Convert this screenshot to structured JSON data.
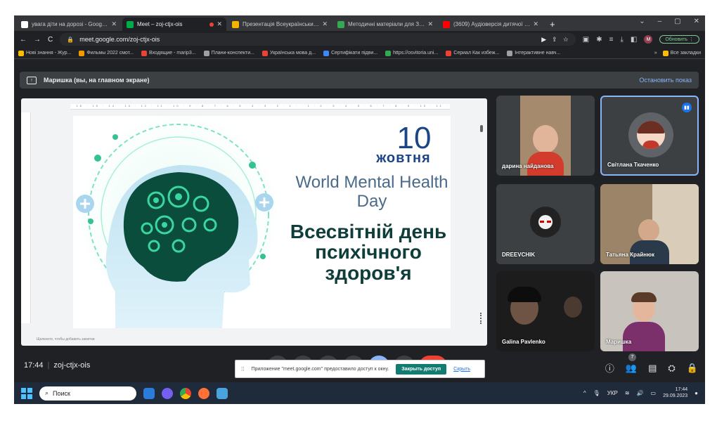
{
  "browser": {
    "tabs": [
      {
        "title": "увага діти на дорозі - Google П...",
        "favicon_color": "#ffffff",
        "active": false,
        "recording": false
      },
      {
        "title": "Meet – zoj-ctjx-ois",
        "favicon_color": "#00ac47",
        "active": true,
        "recording": true
      },
      {
        "title": "Презентація Всеукраїнський ур...",
        "favicon_color": "#f4b400",
        "active": false,
        "recording": false
      },
      {
        "title": "Методичні матеріали для ЗДО ...",
        "favicon_color": "#34a853",
        "active": false,
        "recording": false
      },
      {
        "title": "(3609) Аудіоверсія дитячої книг...",
        "favicon_color": "#ff0000",
        "active": false,
        "recording": false
      }
    ],
    "new_tab_label": "+",
    "window_controls": [
      "⌄",
      "–",
      "▢",
      "✕"
    ],
    "nav": {
      "back": "←",
      "forward": "→",
      "reload": "C"
    },
    "url": "meet.google.com/zoj-ctjx-ois",
    "lock": "🔒",
    "toolbar_icons": [
      "▶",
      "⇪",
      "☆",
      "▣",
      "✱",
      "≡",
      "⤓",
      "◧"
    ],
    "profile_initial": "M",
    "update_button": "Обновить ⋮",
    "bookmarks": [
      {
        "label": "Нові знання - Жур...",
        "color": "#fbbc04"
      },
      {
        "label": "Фильмы 2022 смот...",
        "color": "#f29900"
      },
      {
        "label": "Входящие - marip3...",
        "color": "#ea4335"
      },
      {
        "label": "Плани-конспекти...",
        "color": "#9aa0a6"
      },
      {
        "label": "Українська мова д...",
        "color": "#ea4335"
      },
      {
        "label": "Сертифікати підви...",
        "color": "#4285f4"
      },
      {
        "label": "https://osvitoria.uni...",
        "color": "#34a853"
      },
      {
        "label": "Сериал Как избеж...",
        "color": "#ea4335"
      },
      {
        "label": "Інтерактивне навч...",
        "color": "#9aa0a6"
      }
    ],
    "bookmarks_more": "»",
    "all_bookmarks": "Все закладки"
  },
  "meet": {
    "presenting_label": "Маришка (вы, на главном экране)",
    "stop_showing": "Остановить показ",
    "time": "17:44",
    "meeting_code": "zoj-ctjx-ois",
    "participants_count": "7",
    "participants": [
      {
        "name": "дарина найданова",
        "type": "video",
        "color": "#a68a6e"
      },
      {
        "name": "Світлана Ткаченко",
        "type": "avatar",
        "color": "#7a4a3a",
        "speaking": true
      },
      {
        "name": "DREEVCHIK",
        "type": "avatar-dark",
        "color": "#222222"
      },
      {
        "name": "Татьяна Крайнюк",
        "type": "video",
        "color": "#9c8468"
      },
      {
        "name": "Galina Pavlenko",
        "type": "video",
        "color": "#1c1c1c"
      },
      {
        "name": "Маришка",
        "type": "video",
        "color": "#c9c3bd"
      }
    ],
    "share_notice": {
      "handle": "⁞⁞",
      "text": "Приложение \"meet.google.com\" предоставило доступ к окну.",
      "stop_button": "Закрыть доступ",
      "hide_link": "Скрыть"
    },
    "right_icons": [
      "ⓘ",
      "👥",
      "▤",
      "⛭",
      "🔒"
    ]
  },
  "slide": {
    "day": "10",
    "month": "жовтня",
    "english": "World Mental Health Day",
    "ukrainian": "Всесвітній день психічного здоров'я",
    "notes_hint": "Щелкните, чтобы добавить заметки",
    "ruler_text": "· 16 · 15 · 14 · 13 · 12 · 11 · 10 · 9 · 8 · 7 · 6 · 5 · 4 · 3 · 2 · 1 · · 1 · 2 · 3 · 4 · 5 · 6 · 7 · 8 · 9 · 10 · 11 · 12 · 13 · 14 · 15 · 16 ·",
    "colors": {
      "teal": "#2ec4a0",
      "blue": "#1c4587",
      "green": "#0f3d3a"
    }
  },
  "taskbar": {
    "search_placeholder": "Поиск",
    "tray": {
      "language": "УКР",
      "time": "17:44",
      "date": "29.09.2023"
    },
    "apps": [
      {
        "name": "windows-explorer",
        "color": "#2b7bd8"
      },
      {
        "name": "viber",
        "color": "#7360f2"
      },
      {
        "name": "chrome",
        "color": "#fbbc04"
      },
      {
        "name": "firefox",
        "color": "#ff7139"
      },
      {
        "name": "other-app",
        "color": "#4aa3df"
      }
    ]
  }
}
